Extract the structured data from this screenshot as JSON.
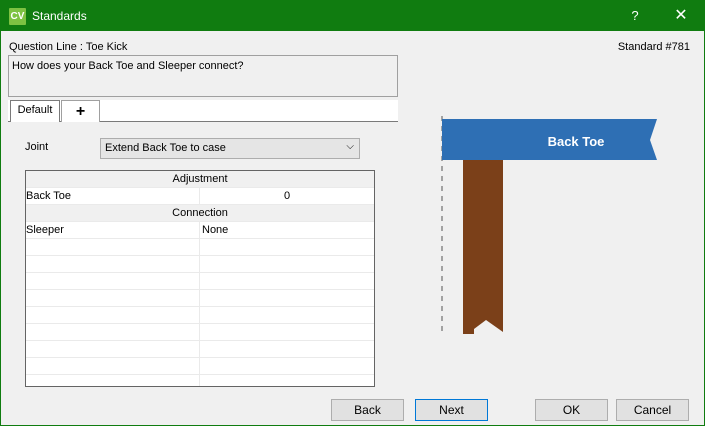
{
  "window": {
    "title": "Standards",
    "icon_text": "CV",
    "help_glyph": "?",
    "close_glyph": "✕"
  },
  "question": {
    "line_label": "Question Line : Toe Kick",
    "standard_label": "Standard #781",
    "text": "How does your Back Toe and Sleeper connect?"
  },
  "tabs": [
    {
      "label": "Default"
    },
    {
      "label": "+"
    }
  ],
  "joint": {
    "label": "Joint",
    "value": "Extend Back Toe to case",
    "arrow": "⌵"
  },
  "grid": {
    "sections": [
      {
        "header": "Adjustment",
        "rows": [
          {
            "name": "Back Toe",
            "value": "0"
          }
        ]
      },
      {
        "header": "Connection",
        "rows": [
          {
            "name": "Sleeper",
            "value": "None"
          }
        ]
      }
    ]
  },
  "diagram": {
    "label": "Back Toe",
    "colors": {
      "label_fill": "#2e6fb4",
      "board": "#7b4019",
      "dash": "#888888"
    }
  },
  "buttons": {
    "back": "Back",
    "next": "Next",
    "ok": "OK",
    "cancel": "Cancel"
  },
  "colors": {
    "titlebar": "#107c10"
  }
}
